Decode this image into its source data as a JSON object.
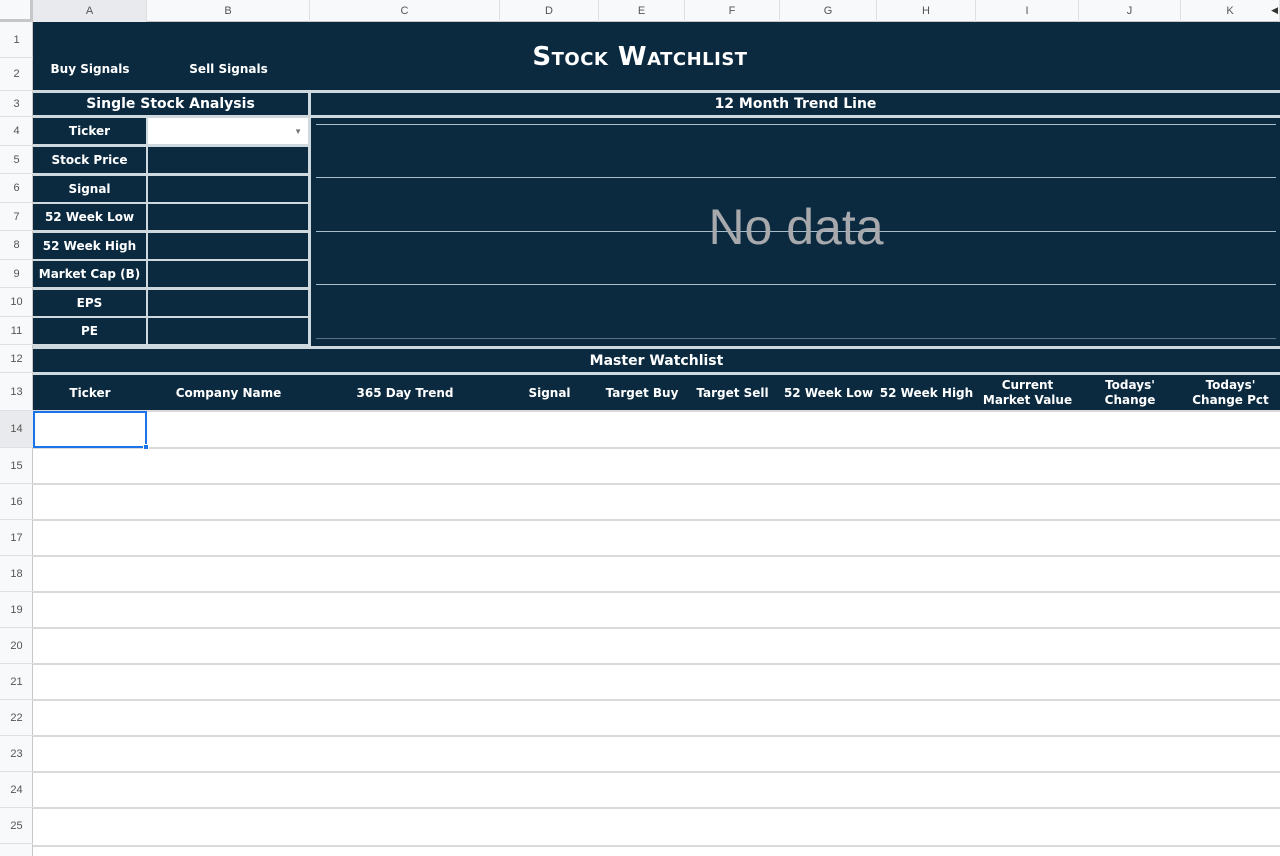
{
  "sheet": {
    "columns": [
      "A",
      "B",
      "C",
      "D",
      "E",
      "F",
      "G",
      "H",
      "I",
      "J",
      "K"
    ],
    "rows": [
      "1",
      "2",
      "3",
      "4",
      "5",
      "6",
      "7",
      "8",
      "9",
      "10",
      "11",
      "12",
      "13",
      "14",
      "15",
      "16",
      "17",
      "18",
      "19",
      "20",
      "21",
      "22",
      "23",
      "24",
      "25"
    ],
    "selected_cell": "A14"
  },
  "header": {
    "title": "Stock Watchlist",
    "buy_signals": "Buy Signals",
    "sell_signals": "Sell Signals"
  },
  "analysis": {
    "title": "Single Stock Analysis",
    "ticker_label": "Ticker",
    "ticker_value": "",
    "fields": [
      {
        "label": "Stock Price",
        "value": ""
      },
      {
        "label": "Signal",
        "value": ""
      },
      {
        "label": "52 Week Low",
        "value": ""
      },
      {
        "label": "52 Week High",
        "value": ""
      },
      {
        "label": "Market Cap (B)",
        "value": ""
      },
      {
        "label": "EPS",
        "value": ""
      },
      {
        "label": "PE",
        "value": ""
      }
    ]
  },
  "trend": {
    "title": "12 Month Trend Line",
    "empty_text": "No data"
  },
  "watchlist": {
    "title": "Master Watchlist",
    "columns": [
      {
        "line1": "Ticker",
        "line2": ""
      },
      {
        "line1": "Company Name",
        "line2": ""
      },
      {
        "line1": "365 Day Trend",
        "line2": ""
      },
      {
        "line1": "Signal",
        "line2": ""
      },
      {
        "line1": "Target Buy",
        "line2": ""
      },
      {
        "line1": "Target Sell",
        "line2": ""
      },
      {
        "line1": "52 Week Low",
        "line2": ""
      },
      {
        "line1": "52 Week High",
        "line2": ""
      },
      {
        "line1": "Current",
        "line2": "Market Value"
      },
      {
        "line1": "Todays'",
        "line2": "Change"
      },
      {
        "line1": "Todays'",
        "line2": "Change Pct"
      }
    ]
  }
}
